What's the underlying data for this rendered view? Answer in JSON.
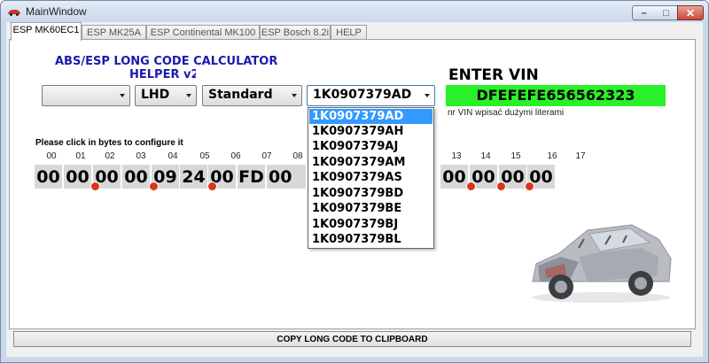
{
  "window": {
    "title": "MainWindow"
  },
  "tabs": [
    {
      "label": "ESP MK60EC1",
      "active": true
    },
    {
      "label": "ESP MK25A",
      "active": false
    },
    {
      "label": "ESP Continental MK100",
      "active": false
    },
    {
      "label": "ESP Bosch 8.2i",
      "active": false
    },
    {
      "label": "HELP",
      "active": false
    }
  ],
  "header": {
    "title_line1": "ABS/ESP LONG CODE CALCULATOR",
    "title_line2": "HELPER v2.",
    "vin_label": "ENTER VIN",
    "vin_value": "DFEFEFE656562323",
    "vin_hint": "nr VIN wpisać dużymi literami"
  },
  "selectors": {
    "first": "",
    "drive_side": "LHD",
    "variant": "Standard",
    "part_number": "1K0907379AD"
  },
  "part_dropdown": {
    "options": [
      "1K0907379AD",
      "1K0907379AH",
      "1K0907379AJ",
      "1K0907379AM",
      "1K0907379AS",
      "1K0907379BD",
      "1K0907379BE",
      "1K0907379BJ",
      "1K0907379BL"
    ],
    "selected": "1K0907379AD"
  },
  "bytes": {
    "instruction": "Please click in bytes to configure it",
    "visible_indices": [
      "00",
      "01",
      "02",
      "03",
      "04",
      "05",
      "06",
      "07",
      "08",
      "13",
      "14",
      "15",
      "16",
      "17"
    ],
    "values_left": [
      "00",
      "00",
      "00",
      "00",
      "09",
      "24",
      "00",
      "FD",
      "00"
    ],
    "values_right": [
      "00",
      "00",
      "00",
      "00"
    ]
  },
  "footer": {
    "copy_label": "COPY LONG CODE TO CLIPBOARD"
  },
  "colors": {
    "vin_bg": "#29f029",
    "heading": "#1a1ab0",
    "bit_dot": "#d9361a",
    "dropdown_selected": "#3399ff"
  },
  "icons": {
    "app": "car-icon",
    "minimize": "minimize-icon",
    "maximize": "maximize-icon",
    "close": "close-icon",
    "dropdown": "chevron-down-icon"
  }
}
